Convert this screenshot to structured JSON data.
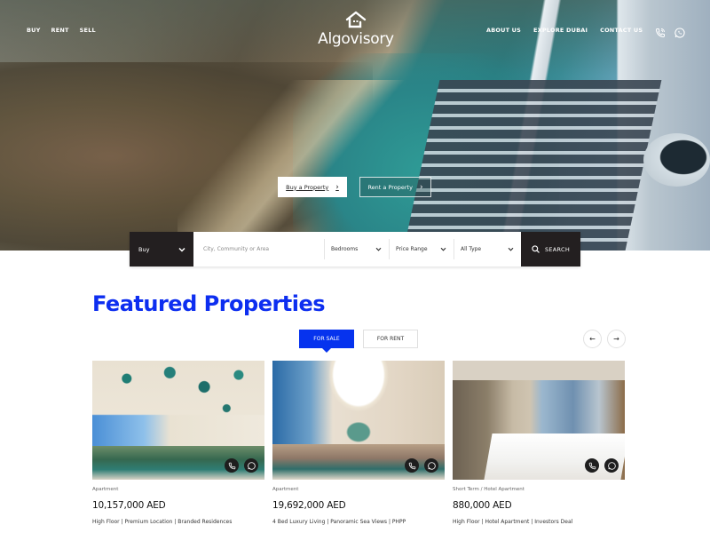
{
  "brand": {
    "name": "Algovisory",
    "logo_icon": "house-icon"
  },
  "nav": {
    "left": [
      {
        "label": "BUY"
      },
      {
        "label": "RENT"
      },
      {
        "label": "SELL"
      }
    ],
    "right": [
      {
        "label": "ABOUT US"
      },
      {
        "label": "EXPLORE DUBAI"
      },
      {
        "label": "CONTACT US"
      }
    ],
    "icons": [
      {
        "name": "phone-icon"
      },
      {
        "name": "whatsapp-icon"
      }
    ]
  },
  "hero": {
    "buy_button": "Buy a Property",
    "rent_button": "Rent a Property",
    "chevron": "›"
  },
  "search": {
    "mode": "Buy",
    "location_placeholder": "City, Community or Area",
    "bedrooms": "Bedrooms",
    "price": "Price Range",
    "type": "All Type",
    "submit": "SEARCH"
  },
  "featured": {
    "title": "Featured Properties",
    "tabs": [
      {
        "label": "FOR SALE",
        "active": true
      },
      {
        "label": "FOR RENT",
        "active": false
      }
    ],
    "prev": "←",
    "next": "→",
    "cards": [
      {
        "type": "Apartment",
        "price": "10,157,000 AED",
        "desc": "High Floor | Premium Location | Branded Residences"
      },
      {
        "type": "Apartment",
        "price": "19,692,000 AED",
        "desc": "4 Bed Luxury Living | Panoramic Sea Views | PHPP"
      },
      {
        "type": "Short Term / Hotel Apartment",
        "price": "880,000 AED",
        "desc": "High Floor | Hotel Apartment | Investors Deal"
      }
    ]
  },
  "colors": {
    "accent": "#0633ee",
    "title": "#0d2ef0",
    "dark": "#231f20"
  }
}
